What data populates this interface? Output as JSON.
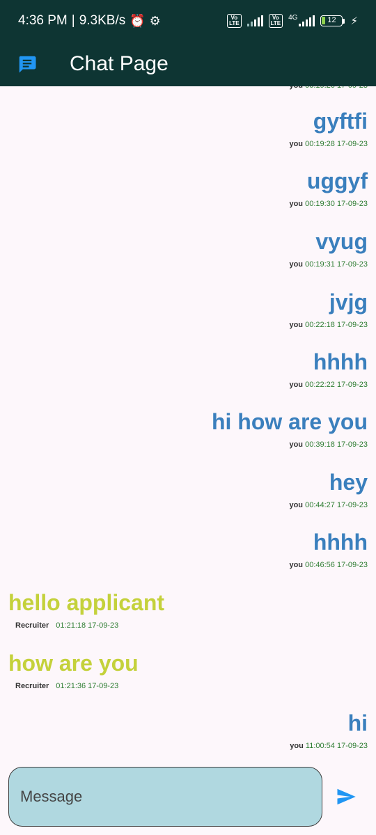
{
  "status_bar": {
    "time": "4:36 PM",
    "network_speed": "9.3KB/s",
    "volte1": "Vo\nLTE",
    "volte2": "Vo\nLTE",
    "network_type": "4G",
    "battery_level": "12"
  },
  "app_bar": {
    "title": "Chat Page",
    "icon": "chat-icon"
  },
  "messages": [
    {
      "text": "gyftfi",
      "sender": "you",
      "time": "00:19:28 17-09-23"
    },
    {
      "text": "uggyf",
      "sender": "you",
      "time": "00:19:30 17-09-23"
    },
    {
      "text": "vyug",
      "sender": "you",
      "time": "00:19:31 17-09-23"
    },
    {
      "text": "jvjg",
      "sender": "you",
      "time": "00:22:18 17-09-23"
    },
    {
      "text": "hhhh",
      "sender": "you",
      "time": "00:22:22 17-09-23"
    },
    {
      "text": "hi how are you",
      "sender": "you",
      "time": "00:39:18 17-09-23"
    },
    {
      "text": "hey",
      "sender": "you",
      "time": "00:44:27 17-09-23"
    },
    {
      "text": "hhhh",
      "sender": "you",
      "time": "00:46:56 17-09-23"
    },
    {
      "text": "hello applicant",
      "sender": "Recruiter",
      "time": "01:21:18 17-09-23"
    },
    {
      "text": "how are you",
      "sender": "Recruiter",
      "time": "01:21:36 17-09-23"
    },
    {
      "text": "hi",
      "sender": "you",
      "time": "11:00:54 17-09-23"
    }
  ],
  "composer": {
    "placeholder": "Message",
    "send_icon": "send-icon"
  },
  "colors": {
    "app_bar": "#0e3533",
    "own_message": "#3a7fbd",
    "other_message": "#c4d13b",
    "timestamp": "#2e7d32",
    "input_fill": "#b0d8e0",
    "send_icon": "#2196f3"
  }
}
